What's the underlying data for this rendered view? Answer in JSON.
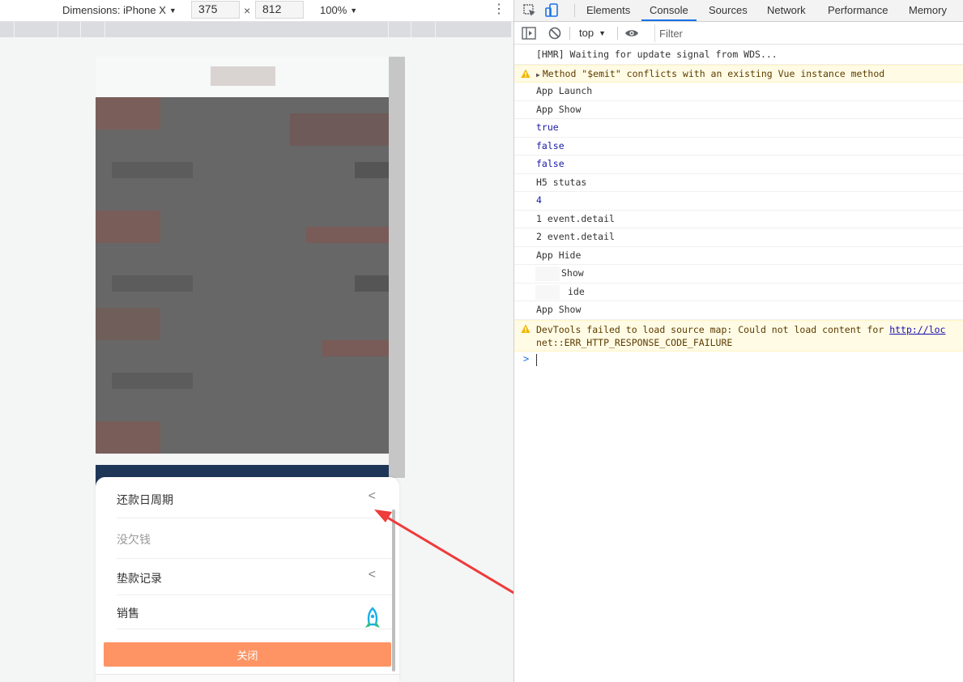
{
  "device_toolbar": {
    "dimensions_label": "Dimensions: iPhone X",
    "width": "375",
    "height": "812",
    "times": "×",
    "zoom": "100%"
  },
  "sheet": {
    "items": [
      {
        "label": "还款日周期",
        "chevron": "<"
      },
      {
        "label": "没欠钱"
      },
      {
        "label": "垫款记录",
        "chevron": "<"
      },
      {
        "label": "销售"
      }
    ],
    "close_label": "关闭",
    "close_color": "#fe9463"
  },
  "devtools": {
    "tabs": [
      "Elements",
      "Console",
      "Sources",
      "Network",
      "Performance",
      "Memory"
    ],
    "active_tab": "Console",
    "context": "top",
    "filter_placeholder": "Filter",
    "accent": "#1a73e8",
    "logs": [
      {
        "type": "log",
        "text": "[HMR] Waiting for update signal from WDS..."
      },
      {
        "type": "warn",
        "text": "Method \"$emit\" conflicts with an existing Vue instance method"
      },
      {
        "type": "log",
        "text": "App Launch"
      },
      {
        "type": "log",
        "text": "App Show"
      },
      {
        "type": "num",
        "text": "true"
      },
      {
        "type": "num",
        "text": "false"
      },
      {
        "type": "num",
        "text": "false"
      },
      {
        "type": "log",
        "text": "H5 stutas"
      },
      {
        "type": "num",
        "text": "4"
      },
      {
        "type": "log",
        "text": "1 event.detail"
      },
      {
        "type": "log",
        "text": "2 event.detail"
      },
      {
        "type": "log",
        "text": "App Hide"
      },
      {
        "type": "log",
        "text": "Show"
      },
      {
        "type": "log",
        "text": "ide"
      },
      {
        "type": "log",
        "text": "App Show"
      }
    ],
    "warn2": {
      "prefix": "DevTools failed to load source map: Could not load content for ",
      "link": "http://loc",
      "line2": "net::ERR_HTTP_RESPONSE_CODE_FAILURE"
    },
    "prompt": ">"
  }
}
